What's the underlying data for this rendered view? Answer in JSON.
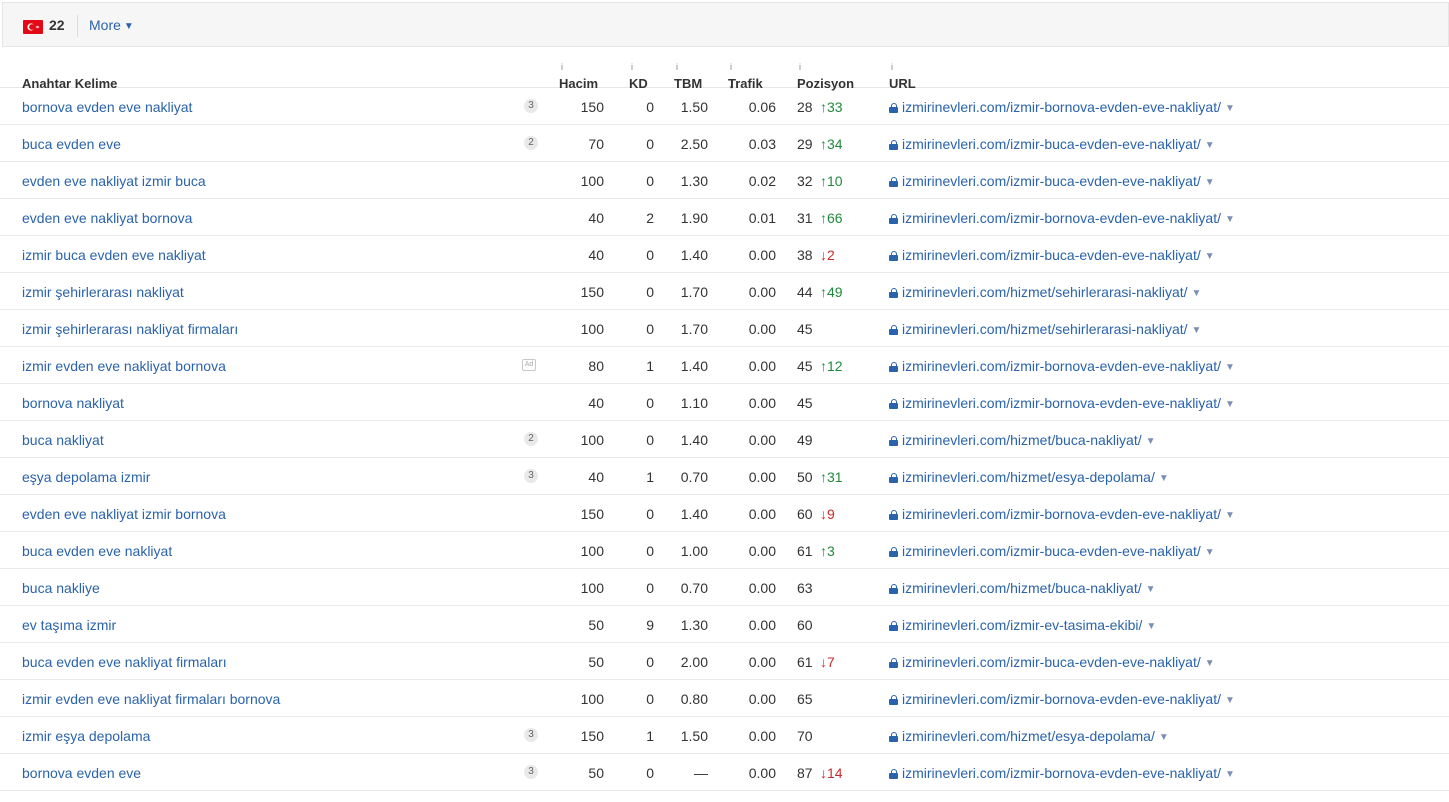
{
  "topbar": {
    "country_count": "22",
    "more_label": "More"
  },
  "columns": {
    "keyword": "Anahtar Kelime",
    "volume": "Hacim",
    "kd": "KD",
    "cpc": "TBM",
    "traffic": "Trafik",
    "position": "Pozisyon",
    "url": "URL"
  },
  "rows": [
    {
      "kw": "bornova evden eve nakliyat",
      "badge": "3",
      "vol": "150",
      "kd": "0",
      "cpc": "1.50",
      "tr": "0.06",
      "pos": "28",
      "chg": "↑33",
      "dir": "up",
      "url": "izmirinevleri.com/izmir-bornova-evden-eve-nakliyat/"
    },
    {
      "kw": "buca evden eve",
      "badge": "2",
      "vol": "70",
      "kd": "0",
      "cpc": "2.50",
      "tr": "0.03",
      "pos": "29",
      "chg": "↑34",
      "dir": "up",
      "url": "izmirinevleri.com/izmir-buca-evden-eve-nakliyat/"
    },
    {
      "kw": "evden eve nakliyat izmir buca",
      "badge": "",
      "vol": "100",
      "kd": "0",
      "cpc": "1.30",
      "tr": "0.02",
      "pos": "32",
      "chg": "↑10",
      "dir": "up",
      "url": "izmirinevleri.com/izmir-buca-evden-eve-nakliyat/"
    },
    {
      "kw": "evden eve nakliyat bornova",
      "badge": "",
      "vol": "40",
      "kd": "2",
      "cpc": "1.90",
      "tr": "0.01",
      "pos": "31",
      "chg": "↑66",
      "dir": "up",
      "url": "izmirinevleri.com/izmir-bornova-evden-eve-nakliyat/"
    },
    {
      "kw": "izmir buca evden eve nakliyat",
      "badge": "",
      "vol": "40",
      "kd": "0",
      "cpc": "1.40",
      "tr": "0.00",
      "pos": "38",
      "chg": "↓2",
      "dir": "down",
      "url": "izmirinevleri.com/izmir-buca-evden-eve-nakliyat/"
    },
    {
      "kw": "izmir şehirlerarası nakliyat",
      "badge": "",
      "vol": "150",
      "kd": "0",
      "cpc": "1.70",
      "tr": "0.00",
      "pos": "44",
      "chg": "↑49",
      "dir": "up",
      "url": "izmirinevleri.com/hizmet/sehirlerarasi-nakliyat/"
    },
    {
      "kw": "izmir şehirlerarası nakliyat firmaları",
      "badge": "",
      "vol": "100",
      "kd": "0",
      "cpc": "1.70",
      "tr": "0.00",
      "pos": "45",
      "chg": "",
      "dir": "",
      "url": "izmirinevleri.com/hizmet/sehirlerarasi-nakliyat/"
    },
    {
      "kw": "izmir evden eve nakliyat bornova",
      "badge": "ad",
      "vol": "80",
      "kd": "1",
      "cpc": "1.40",
      "tr": "0.00",
      "pos": "45",
      "chg": "↑12",
      "dir": "up",
      "url": "izmirinevleri.com/izmir-bornova-evden-eve-nakliyat/"
    },
    {
      "kw": "bornova nakliyat",
      "badge": "",
      "vol": "40",
      "kd": "0",
      "cpc": "1.10",
      "tr": "0.00",
      "pos": "45",
      "chg": "",
      "dir": "",
      "url": "izmirinevleri.com/izmir-bornova-evden-eve-nakliyat/"
    },
    {
      "kw": "buca nakliyat",
      "badge": "2",
      "vol": "100",
      "kd": "0",
      "cpc": "1.40",
      "tr": "0.00",
      "pos": "49",
      "chg": "",
      "dir": "",
      "url": "izmirinevleri.com/hizmet/buca-nakliyat/"
    },
    {
      "kw": "eşya depolama izmir",
      "badge": "3",
      "vol": "40",
      "kd": "1",
      "cpc": "0.70",
      "tr": "0.00",
      "pos": "50",
      "chg": "↑31",
      "dir": "up",
      "url": "izmirinevleri.com/hizmet/esya-depolama/"
    },
    {
      "kw": "evden eve nakliyat izmir bornova",
      "badge": "",
      "vol": "150",
      "kd": "0",
      "cpc": "1.40",
      "tr": "0.00",
      "pos": "60",
      "chg": "↓9",
      "dir": "down",
      "url": "izmirinevleri.com/izmir-bornova-evden-eve-nakliyat/"
    },
    {
      "kw": "buca evden eve nakliyat",
      "badge": "",
      "vol": "100",
      "kd": "0",
      "cpc": "1.00",
      "tr": "0.00",
      "pos": "61",
      "chg": "↑3",
      "dir": "up",
      "url": "izmirinevleri.com/izmir-buca-evden-eve-nakliyat/"
    },
    {
      "kw": "buca nakliye",
      "badge": "",
      "vol": "100",
      "kd": "0",
      "cpc": "0.70",
      "tr": "0.00",
      "pos": "63",
      "chg": "",
      "dir": "",
      "url": "izmirinevleri.com/hizmet/buca-nakliyat/"
    },
    {
      "kw": "ev taşıma izmir",
      "badge": "",
      "vol": "50",
      "kd": "9",
      "cpc": "1.30",
      "tr": "0.00",
      "pos": "60",
      "chg": "",
      "dir": "",
      "url": "izmirinevleri.com/izmir-ev-tasima-ekibi/"
    },
    {
      "kw": "buca evden eve nakliyat firmaları",
      "badge": "",
      "vol": "50",
      "kd": "0",
      "cpc": "2.00",
      "tr": "0.00",
      "pos": "61",
      "chg": "↓7",
      "dir": "down",
      "url": "izmirinevleri.com/izmir-buca-evden-eve-nakliyat/"
    },
    {
      "kw": "izmir evden eve nakliyat firmaları bornova",
      "badge": "",
      "vol": "100",
      "kd": "0",
      "cpc": "0.80",
      "tr": "0.00",
      "pos": "65",
      "chg": "",
      "dir": "",
      "url": "izmirinevleri.com/izmir-bornova-evden-eve-nakliyat/"
    },
    {
      "kw": "izmir eşya depolama",
      "badge": "3",
      "vol": "150",
      "kd": "1",
      "cpc": "1.50",
      "tr": "0.00",
      "pos": "70",
      "chg": "",
      "dir": "",
      "url": "izmirinevleri.com/hizmet/esya-depolama/"
    },
    {
      "kw": "bornova evden eve",
      "badge": "3",
      "vol": "50",
      "kd": "0",
      "cpc": "—",
      "tr": "0.00",
      "pos": "87",
      "chg": "↓14",
      "dir": "down",
      "url": "izmirinevleri.com/izmir-bornova-evden-eve-nakliyat/"
    }
  ]
}
